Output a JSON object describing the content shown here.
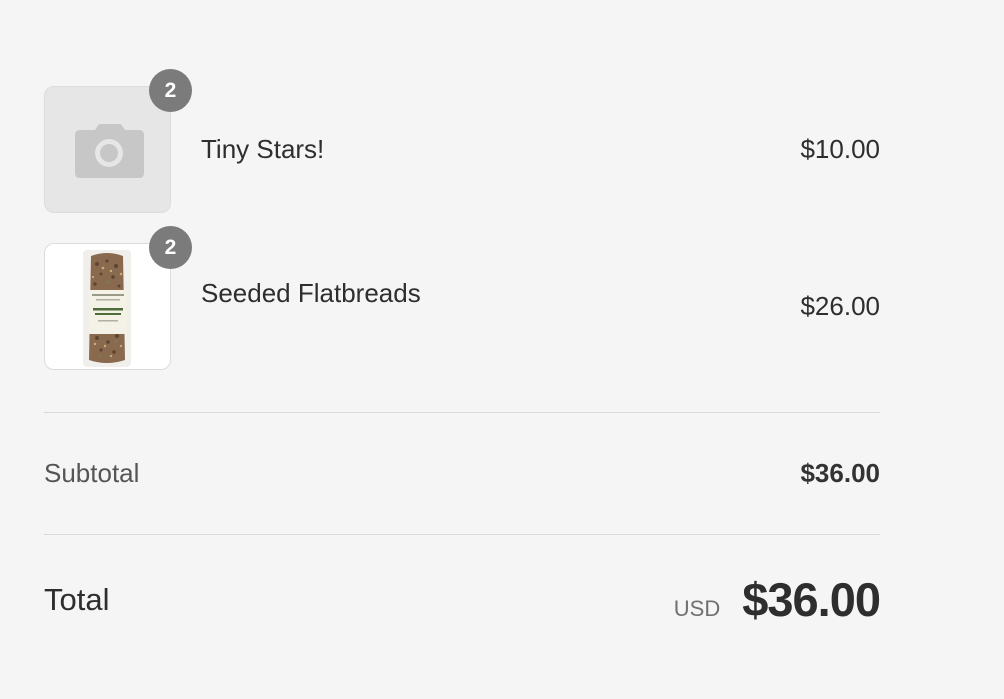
{
  "order_summary": {
    "items": [
      {
        "name": "Tiny Stars!",
        "price": "$10.00",
        "quantity": "2",
        "image": "camera-placeholder-icon"
      },
      {
        "name": "Seeded Flatbreads",
        "price": "$26.00",
        "quantity": "2",
        "image": "seeded-flatbread-product-photo"
      }
    ],
    "subtotal": {
      "label": "Subtotal",
      "value": "$36.00"
    },
    "total": {
      "label": "Total",
      "currency": "USD",
      "value": "$36.00"
    }
  },
  "colors": {
    "background": "#f5f5f5",
    "badge": "#7b7b7b",
    "divider": "#d9d9d9",
    "placeholder": "#e6e6e6"
  }
}
